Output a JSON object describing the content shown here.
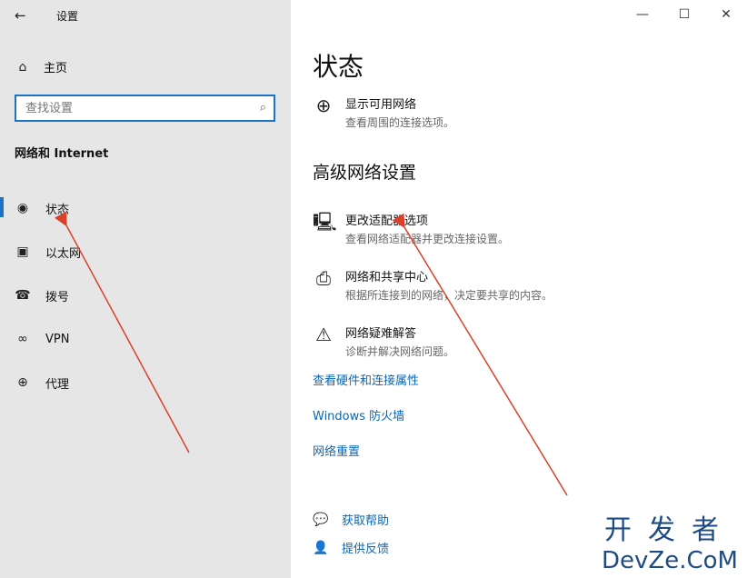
{
  "sidebar": {
    "back_icon": "←",
    "app_title": "设置",
    "home": {
      "icon": "⌂",
      "label": "主页"
    },
    "search": {
      "placeholder": "查找设置",
      "icon": "⌕"
    },
    "section": "网络和 Internet",
    "items": [
      {
        "icon": "◉",
        "label": "状态"
      },
      {
        "icon": "▣",
        "label": "以太网"
      },
      {
        "icon": "☎",
        "label": "拨号"
      },
      {
        "icon": "∞",
        "label": "VPN"
      },
      {
        "icon": "⊕",
        "label": "代理"
      }
    ]
  },
  "window_controls": {
    "minimize": "—",
    "maximize": "☐",
    "close": "✕"
  },
  "main": {
    "title": "状态",
    "show_networks": {
      "icon": "⊕",
      "title": "显示可用网络",
      "desc": "查看周围的连接选项。"
    },
    "advanced_title": "高级网络设置",
    "advanced": [
      {
        "icon": "🖳",
        "title": "更改适配器选项",
        "desc": "查看网络适配器并更改连接设置。"
      },
      {
        "icon": "⎙",
        "title": "网络和共享中心",
        "desc": "根据所连接到的网络，决定要共享的内容。"
      },
      {
        "icon": "⚠",
        "title": "网络疑难解答",
        "desc": "诊断并解决网络问题。"
      }
    ],
    "links": [
      "查看硬件和连接属性",
      "Windows 防火墙",
      "网络重置"
    ],
    "help": [
      {
        "icon": "💬",
        "label": "获取帮助"
      },
      {
        "icon": "👤",
        "label": "提供反馈"
      }
    ]
  },
  "watermark": {
    "line1": "开发者",
    "line2": "DevZe.CoM"
  },
  "annotation_color": "#d9412b"
}
